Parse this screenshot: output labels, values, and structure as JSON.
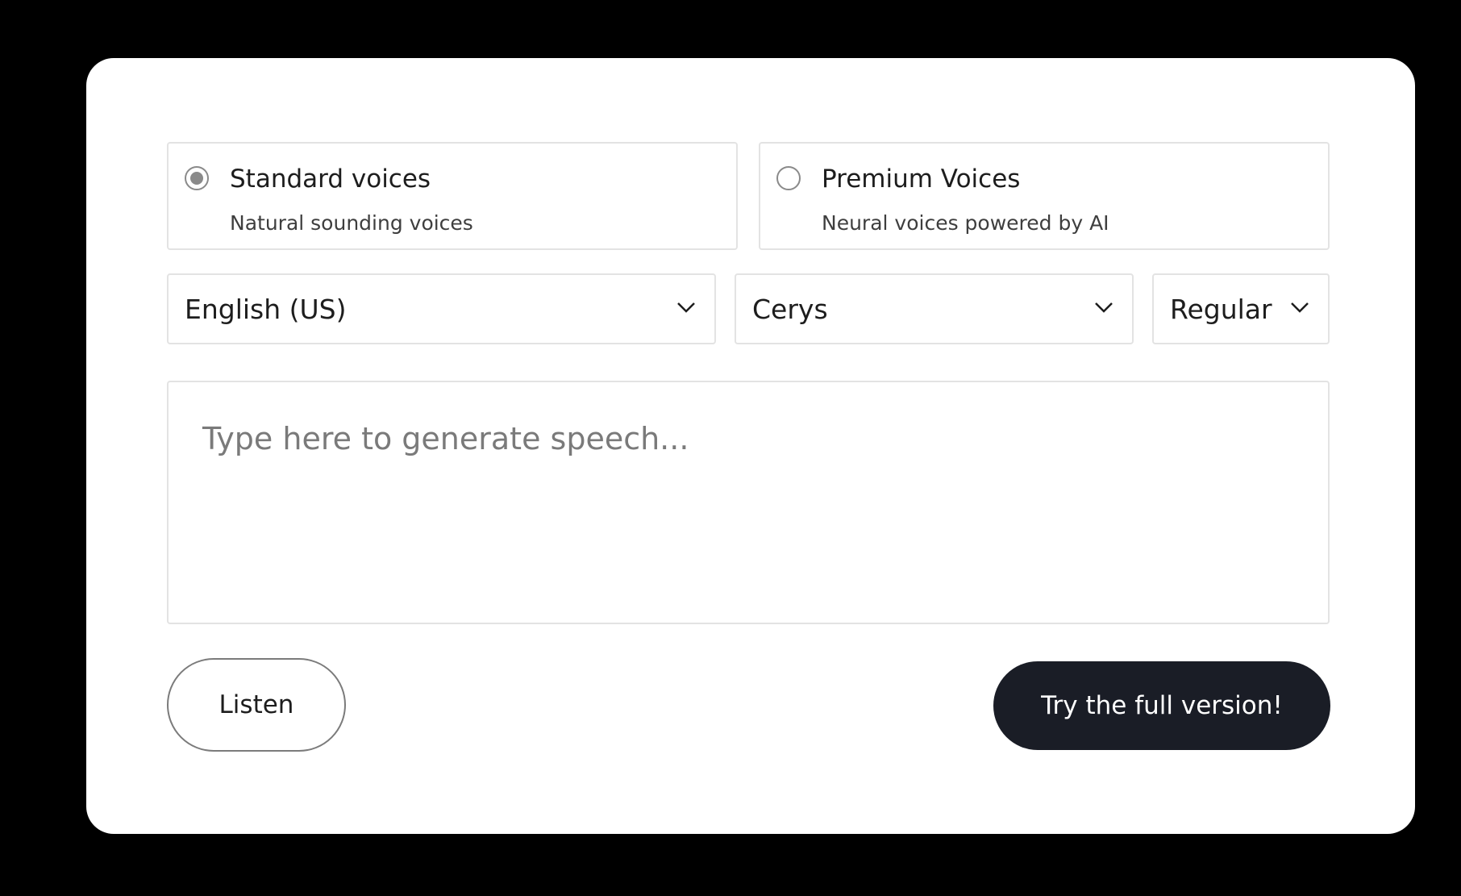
{
  "voice_types": [
    {
      "title": "Standard voices",
      "subtitle": "Natural sounding voices",
      "selected": true
    },
    {
      "title": "Premium Voices",
      "subtitle": "Neural voices powered by AI",
      "selected": false
    }
  ],
  "selects": {
    "language": {
      "value": "English (US)"
    },
    "voice": {
      "value": "Cerys"
    },
    "style": {
      "value": "Regular"
    }
  },
  "text_input": {
    "placeholder": "Type here to generate speech...",
    "value": ""
  },
  "buttons": {
    "listen_label": "Listen",
    "full_version_label": "Try the full version!"
  },
  "icons": {
    "dropdown": "chevron-down-icon"
  },
  "colors": {
    "background": "#000000",
    "card": "#ffffff",
    "primary_button": "#1a1d26",
    "border": "#e3e3e3"
  }
}
